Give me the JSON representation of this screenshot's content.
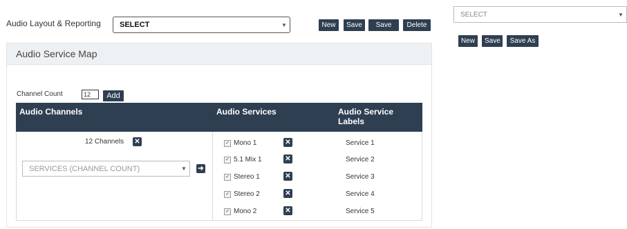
{
  "header": {
    "label": "Audio Layout & Reporting",
    "select_value": "SELECT",
    "buttons": {
      "new": "New",
      "save": "Save",
      "save_as": "Save As",
      "delete": "Delete"
    }
  },
  "right": {
    "select_value": "SELECT",
    "buttons": {
      "new": "New",
      "save": "Save",
      "save_as": "Save As"
    }
  },
  "panel": {
    "title": "Audio Service Map",
    "channel_count_label": "Channel Count",
    "channel_count_value": "12",
    "add_label": "Add",
    "columns": {
      "channels": "Audio Channels",
      "services": "Audio Services",
      "labels_line1": "Audio Service",
      "labels_line2": "Labels"
    },
    "channels_text": "12 Channels",
    "services_select": "SERVICES (CHANNEL COUNT)",
    "services": [
      {
        "name": "Mono 1",
        "label": "Service 1"
      },
      {
        "name": "5.1 Mix 1",
        "label": "Service 2"
      },
      {
        "name": "Stereo 1",
        "label": "Service 3"
      },
      {
        "name": "Stereo 2",
        "label": "Service 4"
      },
      {
        "name": "Mono 2",
        "label": "Service 5"
      }
    ]
  },
  "icons": {
    "remove": "close-icon",
    "caret": "chevron-down-icon",
    "go": "arrow-right-icon",
    "check": "checkbox-checked-icon"
  }
}
